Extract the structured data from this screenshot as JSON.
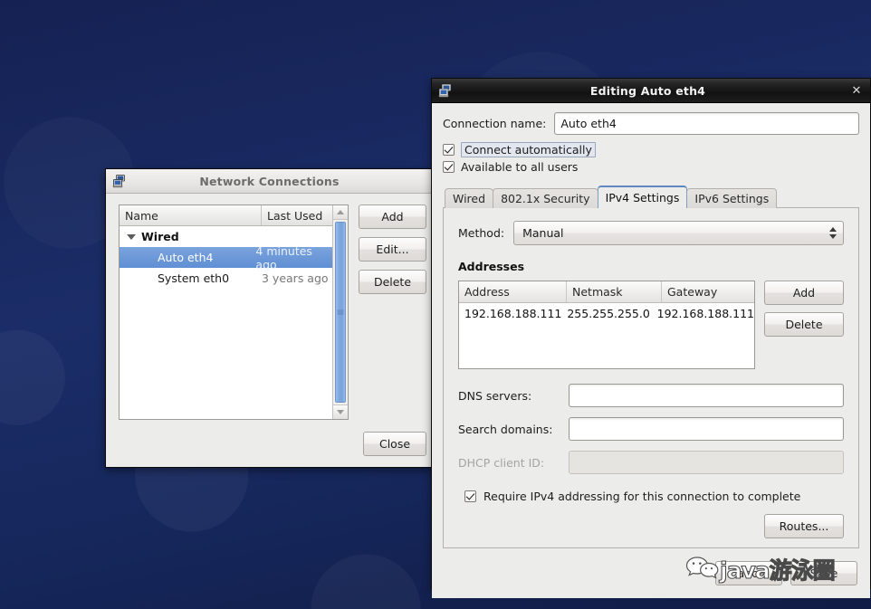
{
  "desktop": {
    "background_color": "#16275c"
  },
  "network_connections_window": {
    "title": "Network Connections",
    "icon": "network-connections-icon",
    "table": {
      "columns": [
        "Name",
        "Last Used"
      ],
      "groups": [
        {
          "label": "Wired",
          "expanded": true,
          "rows": [
            {
              "name": "Auto eth4",
              "last_used": "4 minutes ago",
              "selected": true
            },
            {
              "name": "System eth0",
              "last_used": "3 years ago",
              "selected": false
            }
          ]
        }
      ]
    },
    "buttons": {
      "add": "Add",
      "edit": "Edit...",
      "delete": "Delete",
      "close": "Close"
    }
  },
  "edit_dialog": {
    "title": "Editing Auto eth4",
    "icon": "network-connections-icon",
    "close_label": "✕",
    "connection_name": {
      "label": "Connection name:",
      "value": "Auto eth4",
      "placeholder": ""
    },
    "checkboxes": {
      "connect_automatically": {
        "label": "Connect automatically",
        "checked": true,
        "focused": true
      },
      "available_all_users": {
        "label": "Available to all users",
        "checked": true,
        "focused": false
      }
    },
    "tabs": [
      {
        "label": "Wired",
        "active": false
      },
      {
        "label": "802.1x Security",
        "active": false
      },
      {
        "label": "IPv4 Settings",
        "active": true
      },
      {
        "label": "IPv6 Settings",
        "active": false
      }
    ],
    "ipv4": {
      "method": {
        "label": "Method:",
        "value": "Manual"
      },
      "addresses_title": "Addresses",
      "addresses_table": {
        "columns": [
          "Address",
          "Netmask",
          "Gateway"
        ],
        "rows": [
          {
            "address": "192.168.188.111",
            "netmask": "255.255.255.0",
            "gateway": "192.168.188.111"
          }
        ]
      },
      "address_buttons": {
        "add": "Add",
        "delete": "Delete"
      },
      "dns_servers": {
        "label": "DNS servers:",
        "value": "",
        "placeholder": ""
      },
      "search_domains": {
        "label": "Search domains:",
        "value": "",
        "placeholder": ""
      },
      "dhcp_client_id": {
        "label": "DHCP client ID:",
        "value": "",
        "placeholder": "",
        "disabled": true
      },
      "require_ipv4": {
        "label": "Require IPv4 addressing for this connection to complete",
        "checked": true
      },
      "routes_button": "Routes..."
    },
    "footer": {
      "cancel": "Cancel",
      "save": "Save"
    }
  },
  "watermark": {
    "text": "java游泳圈",
    "logo": "wechat-logo"
  }
}
